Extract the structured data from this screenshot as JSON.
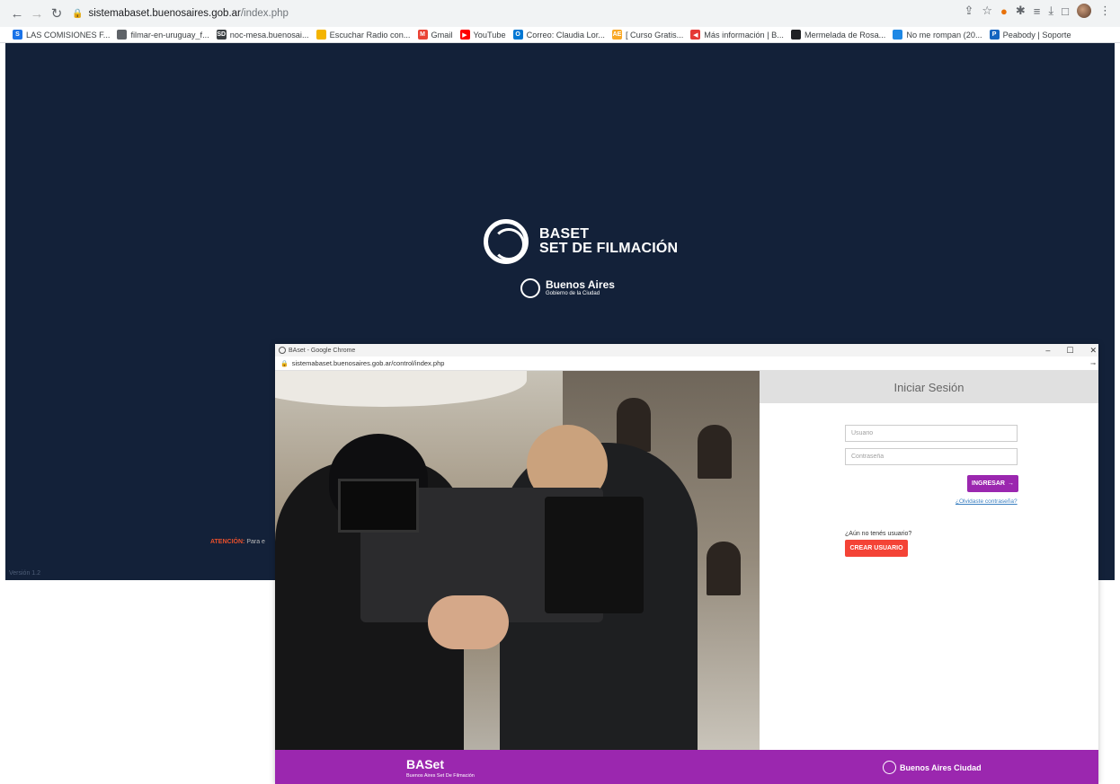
{
  "bg_browser": {
    "url_host": "sistemabaset.buenosaires.gob.ar",
    "url_path": "/index.php",
    "bookmarks": [
      {
        "label": "LAS COMISIONES F...",
        "fav": "S",
        "color": "#1a73e8"
      },
      {
        "label": "filmar-en-uruguay_f...",
        "fav": "",
        "color": "#5f6368"
      },
      {
        "label": "noc-mesa.buenosai...",
        "fav": "SD",
        "color": "#3c4043"
      },
      {
        "label": "Escuchar Radio con...",
        "fav": "",
        "color": "#f4b400"
      },
      {
        "label": "Gmail",
        "fav": "M",
        "color": "#ea4335"
      },
      {
        "label": "YouTube",
        "fav": "▶",
        "color": "#ff0000"
      },
      {
        "label": "Correo: Claudia Lor...",
        "fav": "O",
        "color": "#0078d4"
      },
      {
        "label": "[ Curso Gratis...",
        "fav": "AE",
        "color": "#f9a825"
      },
      {
        "label": "Más información | B...",
        "fav": "◀",
        "color": "#e53935"
      },
      {
        "label": "Mermelada de Rosa...",
        "fav": "",
        "color": "#202124"
      },
      {
        "label": "No me rompan (20...",
        "fav": "",
        "color": "#1e88e5"
      },
      {
        "label": "Peabody | Soporte",
        "fav": "P",
        "color": "#1565c0"
      }
    ],
    "logo_line1": "BASET",
    "logo_line2": "SET DE FILMACIÓN",
    "ba_name": "Buenos Aires",
    "ba_sub": "Gobierno de la Ciudad",
    "atencion_label": "ATENCIÓN:",
    "atencion_text": " Para e",
    "version": "Versión 1.2"
  },
  "fg_window": {
    "title": "BAset - Google Chrome",
    "url": "sistemabaset.buenosaires.gob.ar/control/index.php",
    "login_title": "Iniciar Sesión",
    "usuario_placeholder": "Usuario",
    "password_placeholder": "Contraseña",
    "ingresar_label": "INGRESAR",
    "forgot_label": "¿Olvidaste contraseña?",
    "no_user_label": "¿Aún no tenés usuario?",
    "crear_label": "CREAR USUARIO",
    "footer_brand": "BASet",
    "footer_sub": "Buenos Aires Set De Filmación",
    "footer_ba": "Buenos Aires Ciudad"
  },
  "colors": {
    "page_bg": "#132139",
    "accent_purple": "#9b27af",
    "crear_red": "#f44336",
    "atencion_orange": "#e8502c"
  }
}
